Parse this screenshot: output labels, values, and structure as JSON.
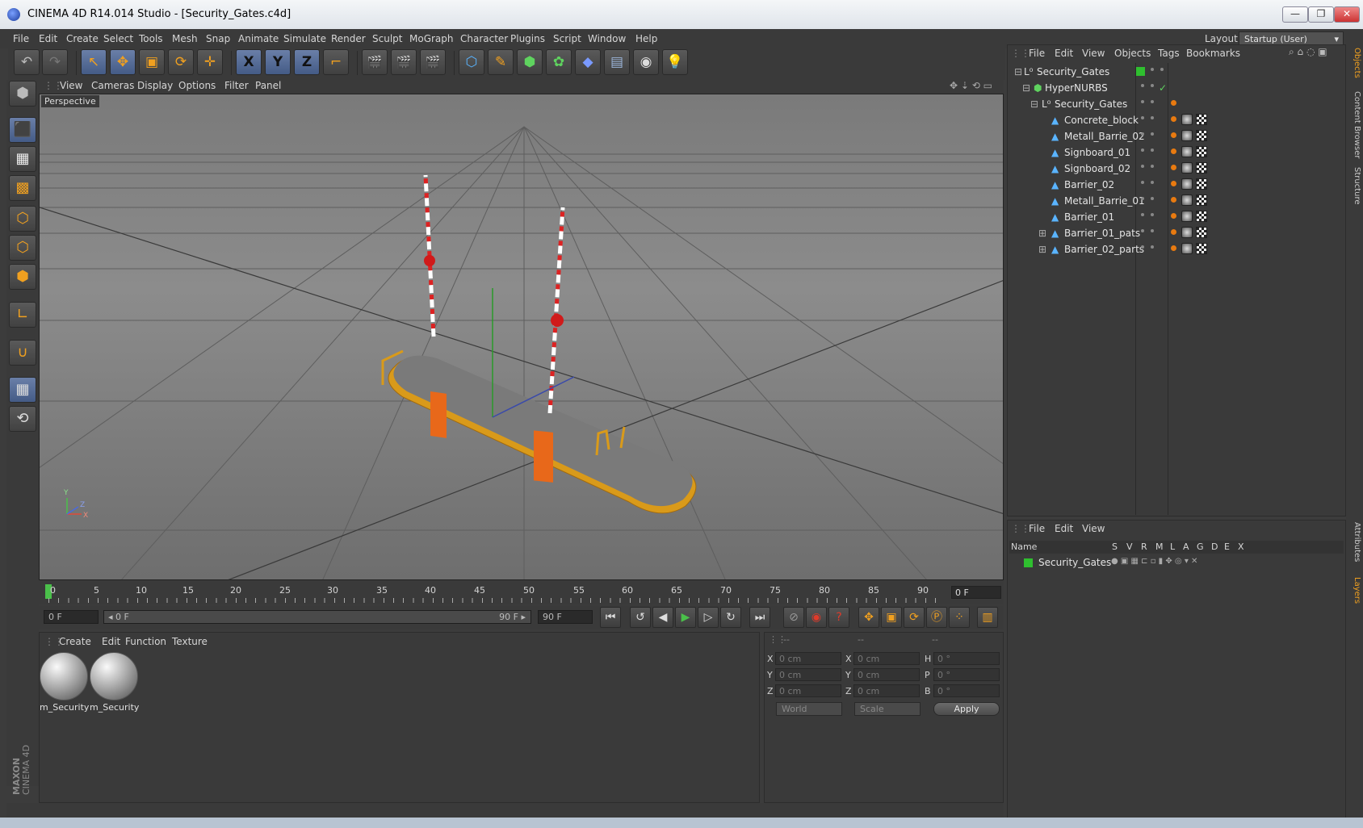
{
  "window": {
    "title": "CINEMA 4D R14.014 Studio - [Security_Gates.c4d]",
    "buttons": {
      "minimize": "—",
      "restore": "❐",
      "close": "✕"
    }
  },
  "menubar": {
    "items": [
      "File",
      "Edit",
      "Create",
      "Select",
      "Tools",
      "Mesh",
      "Snap",
      "Animate",
      "Simulate",
      "Render",
      "Sculpt",
      "MoGraph",
      "Character",
      "Plugins",
      "Script",
      "Window",
      "Help"
    ],
    "layout_label": "Layout:",
    "layout_value": "Startup (User)"
  },
  "toolbar": {
    "undo": "↶",
    "redo": "↷",
    "tools": [
      "↖",
      "✥",
      "▣",
      "⟳",
      "✛"
    ],
    "axes": [
      "X",
      "Y",
      "Z"
    ],
    "coord_system": "⌐",
    "render_buttons": [
      "🎬",
      "🎬",
      "🎬"
    ],
    "create_buttons": [
      "⬡",
      "✎",
      "⬢",
      "✿",
      "◆",
      "▤",
      "◉",
      "💡"
    ]
  },
  "left_toolbar": {
    "icons": [
      "make-editable-icon",
      "model-mode-icon",
      "texture-mode-icon",
      "workplane-icon",
      "points-mode-icon",
      "edges-mode-icon",
      "polygons-mode-icon",
      "axis-mode-icon",
      "magnet-icon",
      "snap-grid-icon",
      "sculpt-icon"
    ]
  },
  "brand": {
    "line1": "MAXON",
    "line2": "CINEMA 4D"
  },
  "viewport": {
    "menu": [
      "View",
      "Cameras",
      "Display",
      "Options",
      "Filter",
      "Panel"
    ],
    "label": "Perspective",
    "axis_labels": {
      "y": "Y",
      "x": "X",
      "z": "Z"
    }
  },
  "timeline": {
    "ticks": [
      "0",
      "5",
      "10",
      "15",
      "20",
      "25",
      "30",
      "35",
      "40",
      "45",
      "50",
      "55",
      "60",
      "65",
      "70",
      "75",
      "80",
      "85",
      "90"
    ],
    "current_frame": "0 F"
  },
  "transport": {
    "start_field": "0 F",
    "range_start": "◂ 0 F",
    "range_end": "90 F ▸",
    "end_field": "90 F",
    "buttons": [
      "⏮",
      "↺",
      "◀",
      "▶",
      "▷",
      "↻",
      "⏭"
    ]
  },
  "material_panel": {
    "menu": [
      "Create",
      "Edit",
      "Function",
      "Texture"
    ],
    "materials": [
      {
        "name": "m_Security"
      },
      {
        "name": "m_Security"
      }
    ]
  },
  "coord_panel": {
    "headers": [
      "--",
      "--",
      "--"
    ],
    "rows": [
      {
        "l1": "X",
        "v1": "0 cm",
        "l2": "X",
        "v2": "0 cm",
        "l3": "H",
        "v3": "0 °"
      },
      {
        "l1": "Y",
        "v1": "0 cm",
        "l2": "Y",
        "v2": "0 cm",
        "l3": "P",
        "v3": "0 °"
      },
      {
        "l1": "Z",
        "v1": "0 cm",
        "l2": "Z",
        "v2": "0 cm",
        "l3": "B",
        "v3": "0 °"
      }
    ],
    "mode": "World",
    "transform": "Scale",
    "apply": "Apply"
  },
  "object_manager": {
    "menu": [
      "File",
      "Edit",
      "View",
      "Objects",
      "Tags",
      "Bookmarks"
    ],
    "objects": [
      {
        "name": "Security_Gates",
        "indent": 0
      },
      {
        "name": "HyperNURBS",
        "indent": 1
      },
      {
        "name": "Security_Gates",
        "indent": 2
      },
      {
        "name": "Concrete_block",
        "indent": 3
      },
      {
        "name": "Metall_Barrie_02",
        "indent": 3
      },
      {
        "name": "Signboard_01",
        "indent": 3
      },
      {
        "name": "Signboard_02",
        "indent": 3
      },
      {
        "name": "Barrier_02",
        "indent": 3
      },
      {
        "name": "Metall_Barrie_01",
        "indent": 3
      },
      {
        "name": "Barrier_01",
        "indent": 3
      },
      {
        "name": "Barrier_01_pats",
        "indent": 3
      },
      {
        "name": "Barrier_02_parts",
        "indent": 3
      }
    ]
  },
  "layer_manager": {
    "menu": [
      "File",
      "Edit",
      "View"
    ],
    "columns": [
      "Name",
      "S",
      "V",
      "R",
      "M",
      "L",
      "A",
      "G",
      "D",
      "E",
      "X"
    ],
    "layers": [
      {
        "name": "Security_Gates",
        "color": "#2fbf2f"
      }
    ]
  },
  "side_tabs": [
    "Objects",
    "Content Browser",
    "Structure",
    "Attributes",
    "Layers"
  ],
  "colors": {
    "accent": "#f0a020",
    "active_blue": "#5570a0",
    "layer_green": "#2fbf2f"
  }
}
